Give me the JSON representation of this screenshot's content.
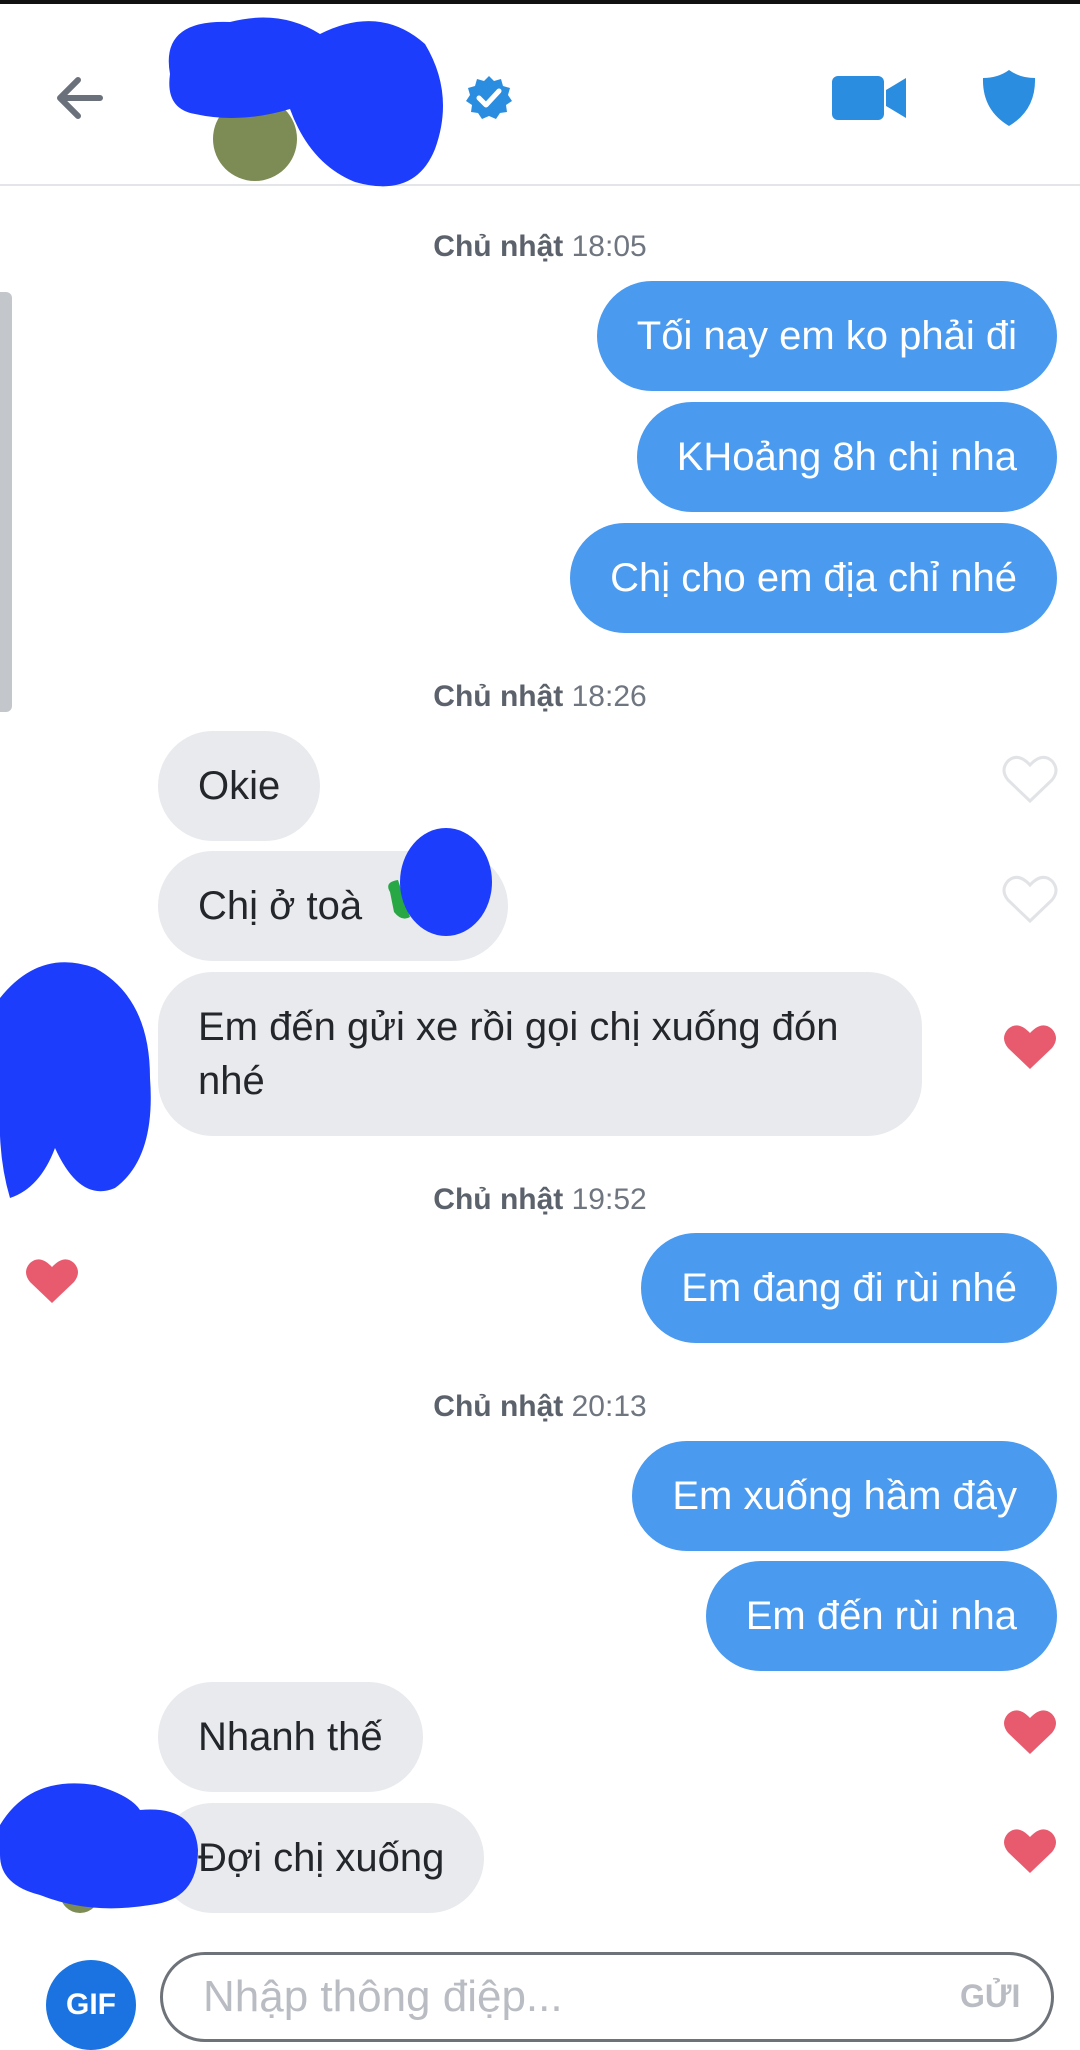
{
  "header": {
    "colors": {
      "accent": "#4a9af0",
      "verified": "#2b8de0"
    }
  },
  "messages": {
    "ts1": {
      "day": "Chủ nhật",
      "time": "18:05"
    },
    "m1": "Tối nay em ko phải đi",
    "m2": "KHoảng 8h chị nha",
    "m3": "Chị cho em địa chỉ nhé",
    "ts2": {
      "day": "Chủ nhật",
      "time": "18:26"
    },
    "m4": "Okie",
    "m5": "Chị ở toà",
    "m6": "Em đến gửi xe rồi gọi chị xuống đón nhé",
    "ts3": {
      "day": "Chủ nhật",
      "time": "19:52"
    },
    "m7": "Em đang đi rùi nhé",
    "ts4": {
      "day": "Chủ nhật",
      "time": "20:13"
    },
    "m8": "Em xuống hầm đây",
    "m9": "Em đến rùi nha",
    "m10": "Nhanh thế",
    "m11": "Đợi chị xuống"
  },
  "composer": {
    "gif_label": "GIF",
    "placeholder": "Nhập thông điệp...",
    "send_label": "GỬI"
  },
  "colors": {
    "outgoing_bubble": "#4a9af0",
    "incoming_bubble": "#e9eaee",
    "heart_liked": "#e85b6e",
    "heart_empty": "#e1e3e6"
  }
}
